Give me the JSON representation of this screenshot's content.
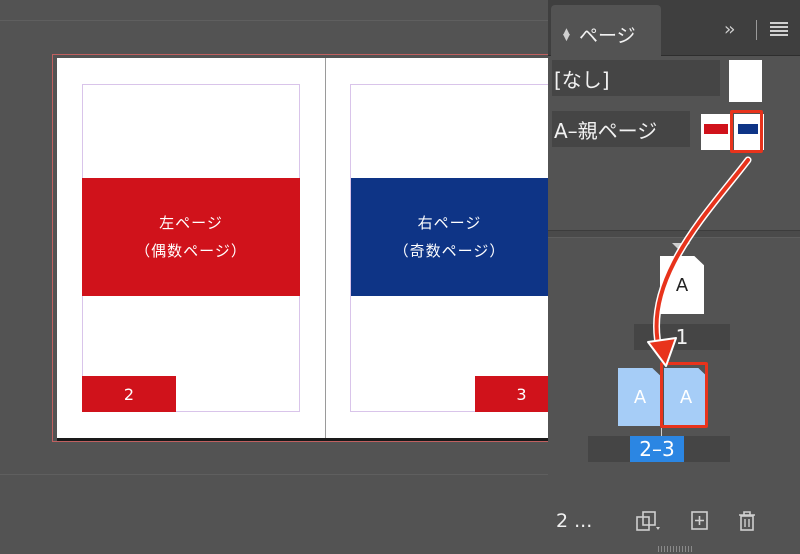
{
  "document": {
    "left_page": {
      "line1": "左ページ",
      "line2": "（偶数ページ）",
      "number": "2",
      "color": "#d0121b"
    },
    "right_page": {
      "line1": "右ページ",
      "line2": "（奇数ページ）",
      "number": "3",
      "color": "#0e3486"
    }
  },
  "pages_panel": {
    "tab_label": "ページ",
    "tab_arrows_icon": "updown-arrows-icon",
    "collapse_icon": "double-chevron-right-icon",
    "menu_icon": "hamburger-menu-icon",
    "parents": [
      {
        "label": "[なし]"
      },
      {
        "label": "A–親ページ"
      }
    ],
    "pages": [
      {
        "thumb_letter": "A",
        "label": "1"
      },
      {
        "thumb_letter": "A"
      },
      {
        "thumb_letter": "A"
      }
    ],
    "spread_label": "2–3",
    "footer": {
      "count": "2 ...",
      "page_size_icon": "page-size-icon",
      "new_page_icon": "new-page-icon",
      "delete_icon": "trash-icon"
    },
    "highlight_color": "#e8331c",
    "selection_color": "#2b86e3"
  }
}
